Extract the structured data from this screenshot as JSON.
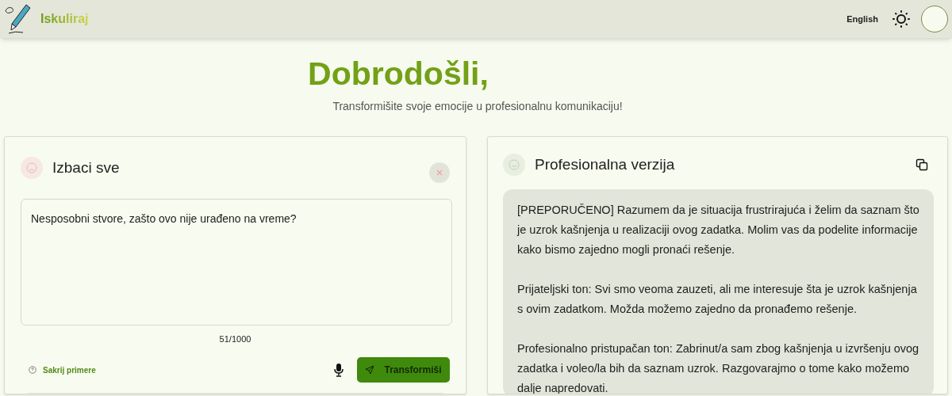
{
  "header": {
    "logo_text": "Iskuliraj",
    "language": "English"
  },
  "hero": {
    "title": "Dobrodošli,",
    "subtitle": "Transformišite svoje emocije u profesionalnu komunikaciju!"
  },
  "input_panel": {
    "title": "Izbaci sve",
    "value": "Nesposobni stvore, zašto ovo nije urađeno na vreme?",
    "counter": "51/1000",
    "examples_toggle": "Sakrij primere",
    "submit": "Transformiši"
  },
  "output_panel": {
    "title": "Profesionalna verzija",
    "paragraphs": [
      "[PREPORUČENO] Razumem da je situacija frustrirajuća i želim da saznam što je uzrok kašnjenja u realizaciji ovog zadatka. Molim vas da podelite informacije kako bismo zajedno mogli pronaći rešenje.",
      "Prijateljski ton: Svi smo veoma zauzeti, ali me interesuje šta je uzrok kašnjenja s ovim zadatkom. Možda možemo zajedno da pronađemo rešenje.",
      "Profesionalno pristupačan ton: Zabrinut/a sam zbog kašnjenja u izvršenju ovog zadatka i voleo/la bih da saznam uzrok. Razgovarajmo o tome kako možemo dalje napredovati."
    ]
  }
}
